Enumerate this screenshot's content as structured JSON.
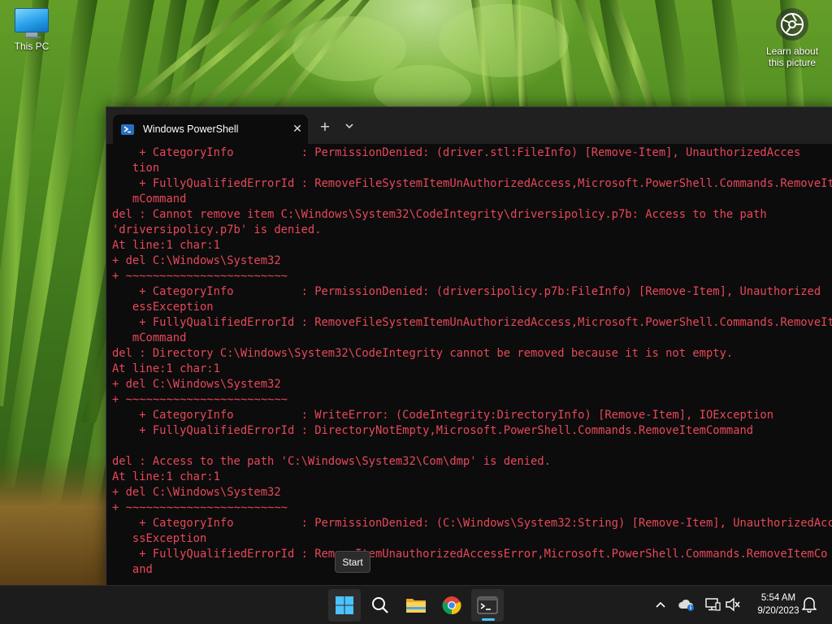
{
  "desktop": {
    "icons": [
      {
        "label": "This PC",
        "icon": "computer-icon"
      },
      {
        "label": "Learn about\nthis picture",
        "icon": "camera-icon"
      }
    ]
  },
  "terminal": {
    "tab_title": "Windows PowerShell",
    "tab_icon": "powershell-icon",
    "new_tab_glyph": "+",
    "close_glyph": "✕",
    "text_color": "#e7485a",
    "background": "#0c0c0c",
    "lines": [
      "    + CategoryInfo          : PermissionDenied: (driver.stl:FileInfo) [Remove-Item], UnauthorizedAcces",
      "   tion",
      "    + FullyQualifiedErrorId : RemoveFileSystemItemUnAuthorizedAccess,Microsoft.PowerShell.Commands.RemoveIte",
      "   mCommand",
      "del : Cannot remove item C:\\Windows\\System32\\CodeIntegrity\\driversipolicy.p7b: Access to the path",
      "'driversipolicy.p7b' is denied.",
      "At line:1 char:1",
      "+ del C:\\Windows\\System32",
      "+ ~~~~~~~~~~~~~~~~~~~~~~~~",
      "    + CategoryInfo          : PermissionDenied: (driversipolicy.p7b:FileInfo) [Remove-Item], Unauthorized",
      "   essException",
      "    + FullyQualifiedErrorId : RemoveFileSystemItemUnAuthorizedAccess,Microsoft.PowerShell.Commands.RemoveIte",
      "   mCommand",
      "del : Directory C:\\Windows\\System32\\CodeIntegrity cannot be removed because it is not empty.",
      "At line:1 char:1",
      "+ del C:\\Windows\\System32",
      "+ ~~~~~~~~~~~~~~~~~~~~~~~~",
      "    + CategoryInfo          : WriteError: (CodeIntegrity:DirectoryInfo) [Remove-Item], IOException",
      "    + FullyQualifiedErrorId : DirectoryNotEmpty,Microsoft.PowerShell.Commands.RemoveItemCommand",
      "",
      "del : Access to the path 'C:\\Windows\\System32\\Com\\dmp' is denied.",
      "At line:1 char:1",
      "+ del C:\\Windows\\System32",
      "+ ~~~~~~~~~~~~~~~~~~~~~~~~",
      "    + CategoryInfo          : PermissionDenied: (C:\\Windows\\System32:String) [Remove-Item], UnauthorizedAcc",
      "   ssException",
      "    + FullyQualifiedErrorId : RemoveItemUnauthorizedAccessError,Microsoft.PowerShell.Commands.RemoveItemCo",
      "   and"
    ]
  },
  "tooltip": {
    "text": "Start"
  },
  "taskbar": {
    "apps": [
      {
        "name": "Start",
        "icon": "windows-logo-icon"
      },
      {
        "name": "Search",
        "icon": "search-icon"
      },
      {
        "name": "File Explorer",
        "icon": "folder-icon"
      },
      {
        "name": "Google Chrome",
        "icon": "chrome-icon"
      },
      {
        "name": "Terminal",
        "icon": "terminal-icon",
        "running": true
      }
    ],
    "tray": {
      "icons": [
        "chevron-up-icon",
        "onedrive-icon",
        "network-icon",
        "volume-muted-icon",
        "notification-bell-icon"
      ],
      "time": "5:54 AM",
      "date": "9/20/2023"
    },
    "accent": "#4cc2ff"
  }
}
